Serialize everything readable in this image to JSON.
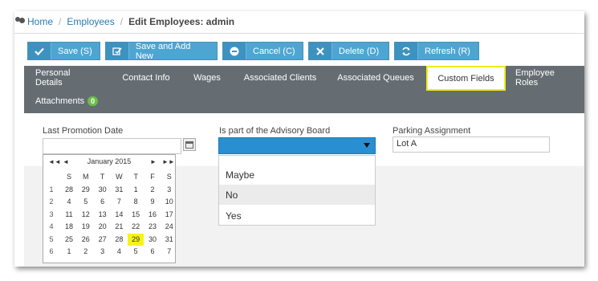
{
  "breadcrumb": {
    "home": "Home",
    "employees": "Employees",
    "current": "Edit Employees: admin"
  },
  "toolbar": {
    "save": "Save (S)",
    "save_add": "Save and Add New",
    "cancel": "Cancel (C)",
    "delete": "Delete (D)",
    "refresh": "Refresh (R)"
  },
  "tabs": {
    "personal": "Personal Details",
    "contact": "Contact Info",
    "wages": "Wages",
    "clients": "Associated Clients",
    "queues": "Associated Queues",
    "custom": "Custom Fields",
    "roles": "Employee Roles",
    "attachments": "Attachments",
    "attachments_count": "0"
  },
  "fields": {
    "promotion_label": "Last Promotion Date",
    "promotion_value": "",
    "advisory_label": "Is part of the Advisory Board",
    "advisory_value": "",
    "advisory_options": [
      "Maybe",
      "No",
      "Yes"
    ],
    "parking_label": "Parking Assignment",
    "parking_value": "Lot A"
  },
  "calendar": {
    "month": "January 2015",
    "prev_year": "◄◄",
    "prev": "◄",
    "next": "►",
    "next_year": "►►",
    "dow": [
      "S",
      "M",
      "T",
      "W",
      "T",
      "F",
      "S"
    ],
    "weeks": [
      {
        "wk": "1",
        "days": [
          [
            "28",
            true
          ],
          [
            "29",
            true
          ],
          [
            "30",
            true
          ],
          [
            "31",
            true
          ],
          [
            "1",
            false
          ],
          [
            "2",
            false
          ],
          [
            "3",
            false
          ]
        ]
      },
      {
        "wk": "2",
        "days": [
          [
            "4",
            false
          ],
          [
            "5",
            false
          ],
          [
            "6",
            false
          ],
          [
            "7",
            false
          ],
          [
            "8",
            false
          ],
          [
            "9",
            false
          ],
          [
            "10",
            false
          ]
        ]
      },
      {
        "wk": "3",
        "days": [
          [
            "11",
            false
          ],
          [
            "12",
            false
          ],
          [
            "13",
            false
          ],
          [
            "14",
            false
          ],
          [
            "15",
            false
          ],
          [
            "16",
            false
          ],
          [
            "17",
            false
          ]
        ]
      },
      {
        "wk": "4",
        "days": [
          [
            "18",
            false
          ],
          [
            "19",
            false
          ],
          [
            "20",
            false
          ],
          [
            "21",
            false
          ],
          [
            "22",
            false
          ],
          [
            "23",
            false
          ],
          [
            "24",
            false
          ]
        ]
      },
      {
        "wk": "5",
        "days": [
          [
            "25",
            false
          ],
          [
            "26",
            false
          ],
          [
            "27",
            false
          ],
          [
            "28",
            false
          ],
          [
            "29",
            false
          ],
          [
            "30",
            false
          ],
          [
            "31",
            false
          ]
        ]
      },
      {
        "wk": "6",
        "days": [
          [
            "1",
            true
          ],
          [
            "2",
            true
          ],
          [
            "3",
            true
          ],
          [
            "4",
            true
          ],
          [
            "5",
            true
          ],
          [
            "6",
            true
          ],
          [
            "7",
            true
          ]
        ]
      }
    ],
    "selected": "29"
  }
}
